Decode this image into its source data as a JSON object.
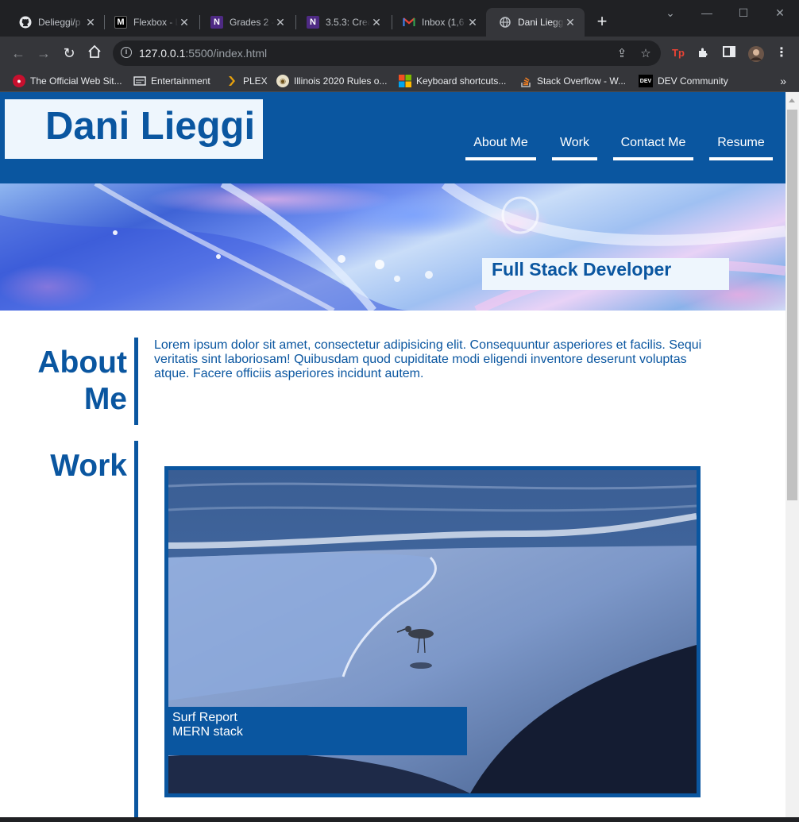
{
  "browser": {
    "tabs": [
      {
        "title": "Delieggi/p",
        "icon": "github-icon"
      },
      {
        "title": "Flexbox - L",
        "icon": "medium-icon"
      },
      {
        "title": "Grades 2 -",
        "icon": "northwestern-icon"
      },
      {
        "title": "3.5.3: Creat",
        "icon": "northwestern-icon"
      },
      {
        "title": "Inbox (1,6",
        "icon": "gmail-icon"
      },
      {
        "title": "Dani Liegg",
        "icon": "globe-icon",
        "active": true
      }
    ],
    "address": {
      "host": "127.0.0.1",
      "rest": ":5500/index.html"
    },
    "bookmarks": [
      {
        "label": "The Official Web Sit...",
        "icon": "blackhawks-icon"
      },
      {
        "label": "Entertainment",
        "icon": "folder-icon"
      },
      {
        "label": "PLEX",
        "icon": "plex-icon"
      },
      {
        "label": "Illinois 2020 Rules o...",
        "icon": "illinois-seal-icon"
      },
      {
        "label": "Keyboard shortcuts...",
        "icon": "microsoft-icon"
      },
      {
        "label": "Stack Overflow - W...",
        "icon": "stackoverflow-icon"
      },
      {
        "label": "DEV Community",
        "icon": "dev-icon"
      }
    ]
  },
  "site": {
    "logo": "Dani Lieggi",
    "nav": [
      "About Me",
      "Work",
      "Contact Me",
      "Resume"
    ],
    "hero_label": "Full Stack Developer",
    "about": {
      "title_line1": "About",
      "title_line2": "Me",
      "body": "Lorem ipsum dolor sit amet, consectetur adipisicing elit. Consequuntur asperiores et facilis. Sequi veritatis sint laboriosam! Quibusdam quod cupiditate modi eligendi inventore deserunt voluptas atque. Facere officiis asperiores incidunt autem."
    },
    "work": {
      "title": "Work",
      "project_name": "Surf Report",
      "project_stack": "MERN stack"
    }
  },
  "colors": {
    "brand": "#0a56a0",
    "light_box": "#eef6fd"
  }
}
